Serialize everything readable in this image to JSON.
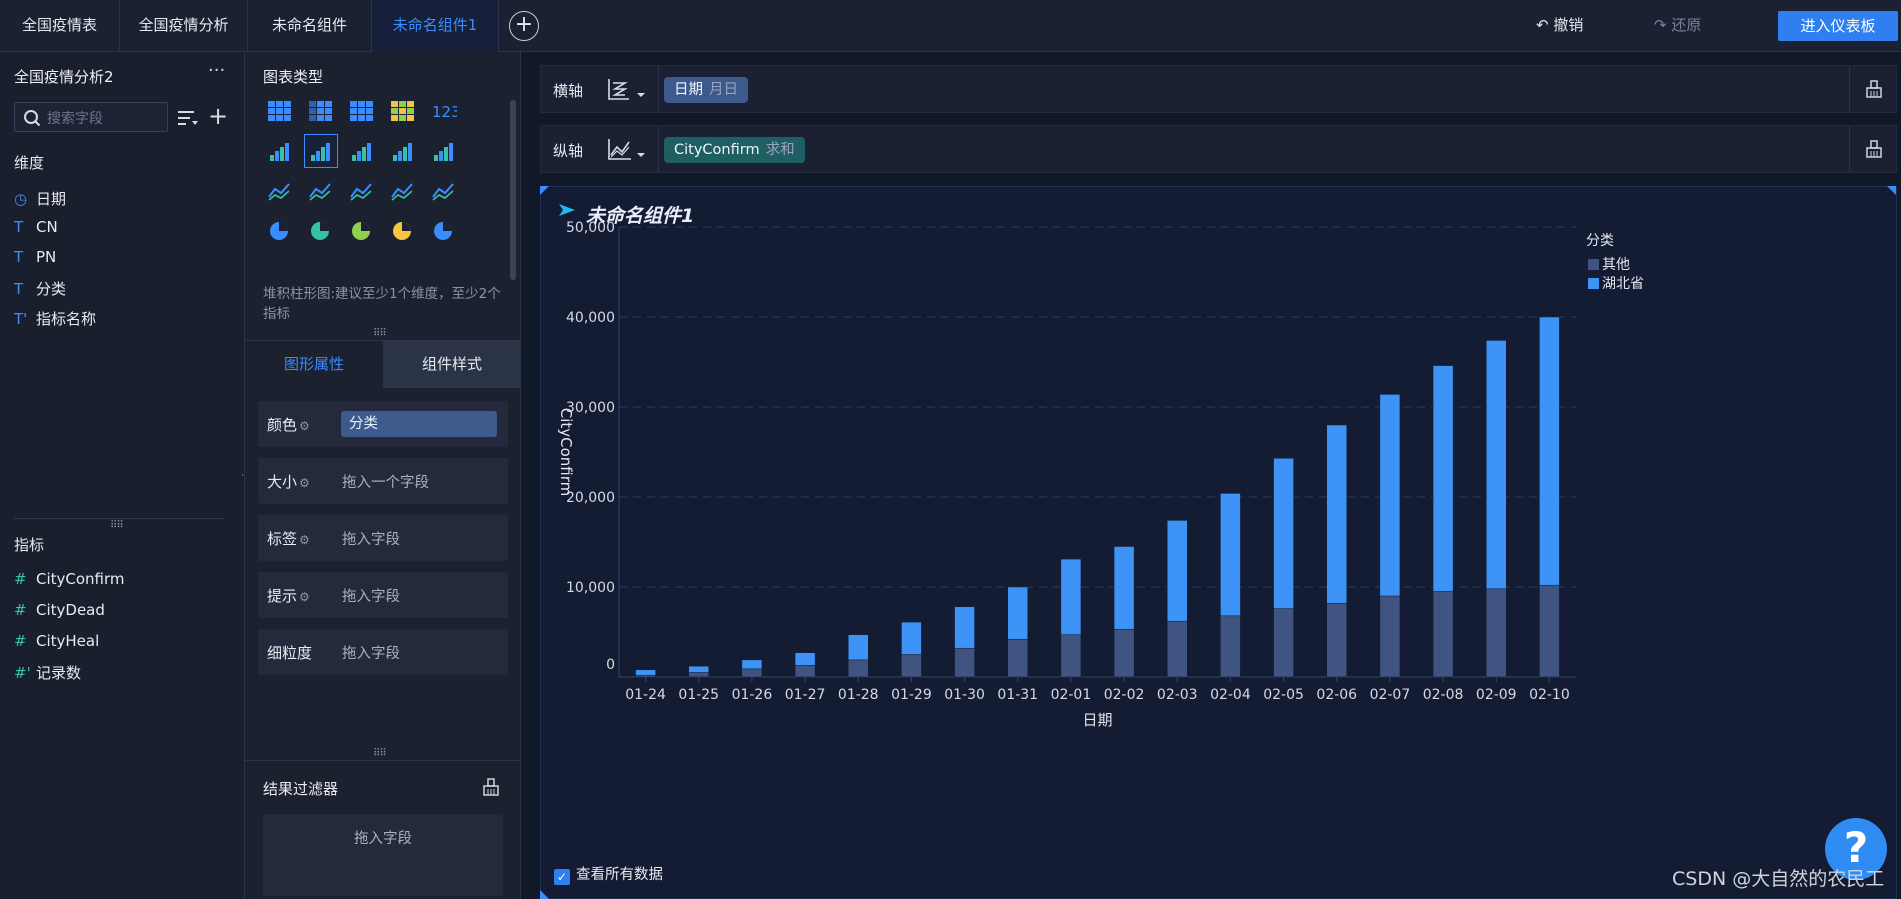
{
  "tabs": [
    {
      "label": "全国疫情表"
    },
    {
      "label": "全国疫情分析"
    },
    {
      "label": "未命名组件"
    },
    {
      "label": "未命名组件1"
    }
  ],
  "toolbar": {
    "undo": "撤销",
    "redo": "还原",
    "enter_dashboard": "进入仪表板"
  },
  "left_panel": {
    "title": "全国疫情分析2",
    "search_placeholder": "搜索字段",
    "dimensions_label": "维度",
    "dimensions": [
      {
        "icon": "T-icon",
        "label": "日期",
        "type": "date"
      },
      {
        "icon": "T-icon",
        "label": "CN",
        "type": "text"
      },
      {
        "icon": "T-icon",
        "label": "PN",
        "type": "text"
      },
      {
        "icon": "T-icon",
        "label": "分类",
        "type": "text"
      },
      {
        "icon": "T-icon",
        "label": "指标名称",
        "type": "calc-text"
      }
    ],
    "metrics_label": "指标",
    "metrics": [
      {
        "label": "CityConfirm"
      },
      {
        "label": "CityDead"
      },
      {
        "label": "CityHeal"
      },
      {
        "label": "记录数"
      }
    ]
  },
  "middle_panel": {
    "chart_type_label": "图表类型",
    "chart_hint": "堆积柱形图:建议至少1个维度，至少2个指标",
    "prop_tabs": {
      "graphic": "图形属性",
      "style": "组件样式"
    },
    "props": [
      {
        "label": "颜色",
        "value": "分类"
      },
      {
        "label": "大小",
        "value": "拖入一个字段"
      },
      {
        "label": "标签",
        "value": "拖入字段"
      },
      {
        "label": "提示",
        "value": "拖入字段"
      },
      {
        "label": "细粒度",
        "value": "拖入字段"
      }
    ],
    "filter_label": "结果过滤器",
    "filter_drop": "拖入字段"
  },
  "axes": {
    "x_label": "横轴",
    "x_chip": {
      "field": "日期",
      "sub": "月日"
    },
    "y_label": "纵轴",
    "y_chip": {
      "field": "CityConfirm",
      "sub": "求和"
    }
  },
  "component_title": "未命名组件1",
  "show_all_data": "查看所有数据",
  "watermark": "CSDN @大自然的农民工",
  "colors": {
    "accent": "#2f7ff0",
    "series_other": "#3f5480",
    "series_hubei": "#3d94f6",
    "y_chip": "#1e5f64"
  },
  "chart_data": {
    "type": "bar",
    "stacked": true,
    "xlabel": "日期",
    "ylabel": "CityConfirm",
    "ylim": [
      0,
      50000
    ],
    "yticks": [
      "0",
      "10,000",
      "20,000",
      "30,000",
      "40,000",
      "50,000"
    ],
    "grid": true,
    "legend_title": "分类",
    "legend_position": "top-right",
    "categories": [
      "01-24",
      "01-25",
      "01-26",
      "01-27",
      "01-28",
      "01-29",
      "01-30",
      "01-31",
      "02-01",
      "02-02",
      "02-03",
      "02-04",
      "02-05",
      "02-06",
      "02-07",
      "02-08",
      "02-09",
      "02-10"
    ],
    "series": [
      {
        "name": "其他",
        "color": "#3f5480",
        "values": [
          200,
          500,
          900,
          1300,
          1900,
          2500,
          3200,
          4200,
          4700,
          5300,
          6200,
          6800,
          7600,
          8200,
          9000,
          9500,
          9800,
          10200
        ]
      },
      {
        "name": "湖北省",
        "color": "#3d94f6",
        "values": [
          600,
          700,
          1000,
          1400,
          2800,
          3600,
          4600,
          5800,
          8400,
          9200,
          11200,
          13600,
          16700,
          19800,
          22400,
          25100,
          27600,
          29800
        ]
      }
    ]
  }
}
